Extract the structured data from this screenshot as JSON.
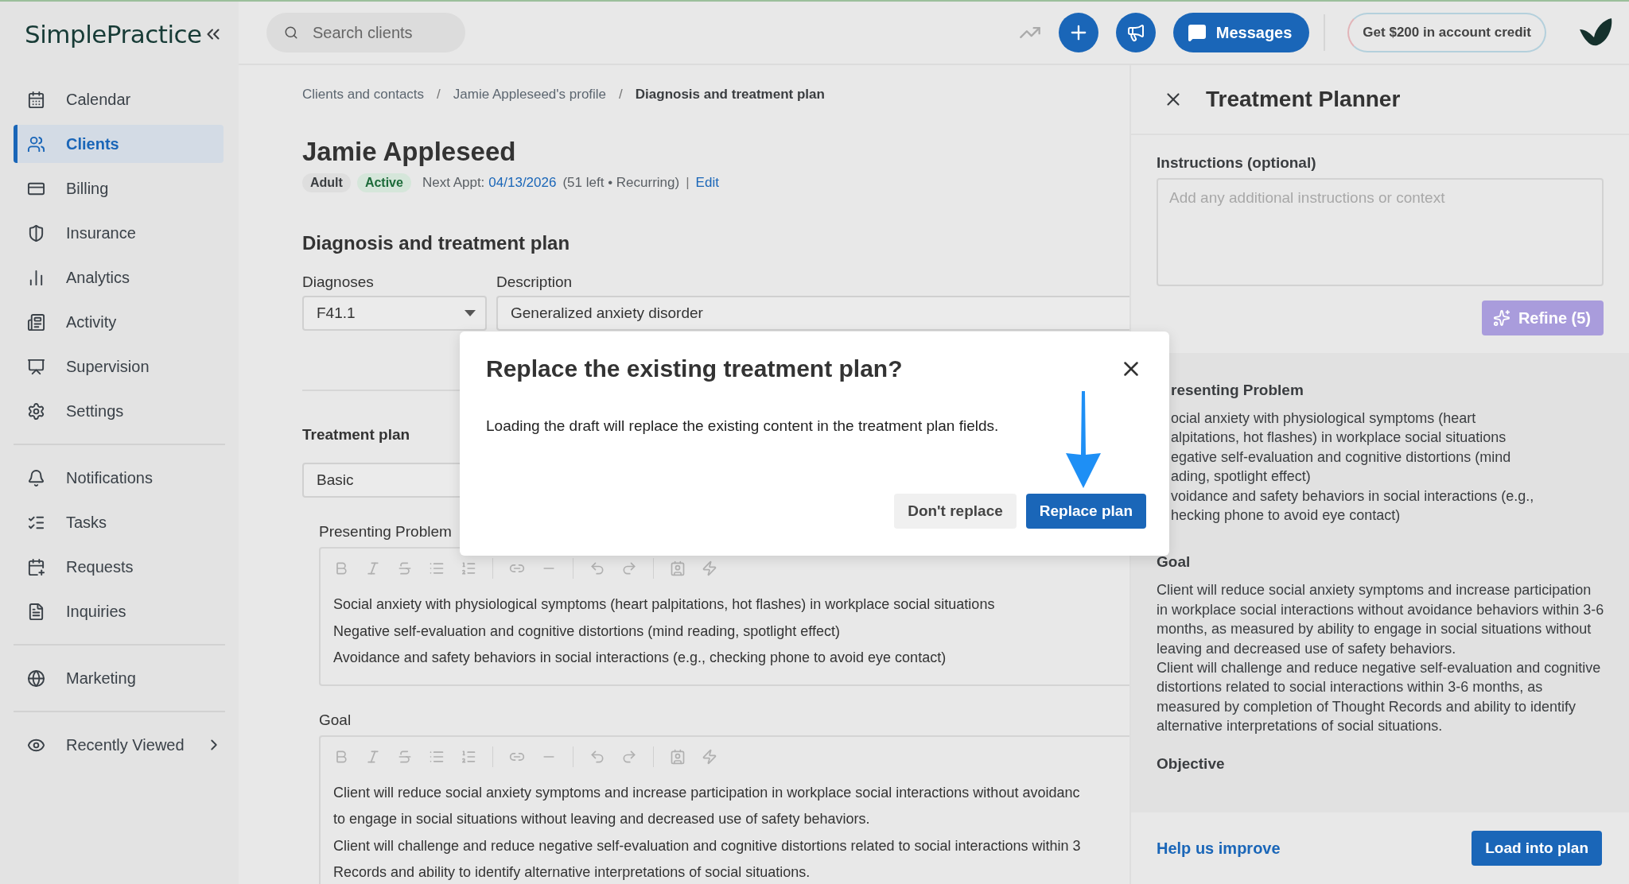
{
  "logo": {
    "text": "SimplePractice"
  },
  "sidebar": {
    "groups": [
      [
        {
          "label": "Calendar",
          "kind": "link",
          "selected": false
        },
        {
          "label": "Clients",
          "kind": "link",
          "selected": true
        },
        {
          "label": "Billing",
          "kind": "link",
          "selected": false
        },
        {
          "label": "Insurance",
          "kind": "link",
          "selected": false
        },
        {
          "label": "Analytics",
          "kind": "link",
          "selected": false
        },
        {
          "label": "Activity",
          "kind": "link",
          "selected": false
        },
        {
          "label": "Supervision",
          "kind": "link",
          "selected": false
        },
        {
          "label": "Settings",
          "kind": "link",
          "selected": false
        }
      ],
      [
        {
          "label": "Notifications",
          "kind": "link",
          "selected": false
        },
        {
          "label": "Tasks",
          "kind": "link",
          "selected": false
        },
        {
          "label": "Requests",
          "kind": "link",
          "selected": false
        },
        {
          "label": "Inquiries",
          "kind": "link",
          "selected": false
        }
      ],
      [
        {
          "label": "Marketing",
          "kind": "link",
          "selected": false
        }
      ],
      [
        {
          "label": "Recently Viewed",
          "kind": "submenu",
          "selected": false
        }
      ]
    ]
  },
  "topbar": {
    "search": {
      "placeholder": "Search clients"
    },
    "messages_button": "Messages",
    "credit_button": "Get $200 in account credit"
  },
  "breadcrumbs": [
    {
      "label": "Clients and contacts",
      "current": false
    },
    {
      "label": "Jamie Appleseed's profile",
      "current": false
    },
    {
      "label": "Diagnosis and treatment plan",
      "current": true
    }
  ],
  "breadcrumb_separator": "/",
  "client": {
    "name": "Jamie Appleseed",
    "badges": [
      {
        "label": "Adult",
        "kind": "neutral"
      },
      {
        "label": "Active",
        "kind": "success"
      }
    ],
    "next_appt_label": "Next Appt:",
    "next_appt_date": "04/13/2026",
    "next_appt_info": "(51 left • Recurring)",
    "separator": "|",
    "edit_link": "Edit"
  },
  "section_title": "Diagnosis and treatment plan",
  "diagnosis": {
    "code_label": "Diagnoses",
    "code": "F41.1",
    "description_label": "Description",
    "description": "Generalized anxiety disorder"
  },
  "treatment_plan": {
    "label": "Treatment plan",
    "template": "Basic",
    "sections": [
      {
        "label": "Presenting Problem",
        "lines": [
          "Social anxiety with physiological symptoms (heart palpitations, hot flashes) in workplace social situations",
          "Negative self-evaluation and cognitive distortions (mind reading, spotlight effect)",
          "Avoidance and safety behaviors in social interactions (e.g., checking phone to avoid eye contact)"
        ]
      },
      {
        "label": "Goal",
        "lines": [
          "Client will reduce social anxiety symptoms and increase participation in workplace social interactions without avoidanc",
          "to engage in social situations without leaving and decreased use of safety behaviors.",
          "Client will challenge and reduce negative self-evaluation and cognitive distortions related to social interactions within 3",
          "Records and ability to identify alternative interpretations of social situations."
        ]
      }
    ]
  },
  "planner": {
    "title": "Treatment Planner",
    "instructions_label": "Instructions (optional)",
    "instructions_placeholder": "Add any additional instructions or context",
    "refine_button": "Refine (5)",
    "refine_disabled": true,
    "sections": [
      {
        "heading": "resenting Problem",
        "partly_hidden": true,
        "lines": [
          "ocial anxiety with physiological symptoms (heart",
          "alpitations, hot flashes) in workplace social situations",
          "egative self-evaluation and cognitive distortions (mind",
          "ading, spotlight effect)",
          "voidance and safety behaviors in social interactions (e.g.,",
          "hecking phone to avoid eye contact)"
        ]
      },
      {
        "heading": "Goal",
        "partly_hidden": false,
        "lines": [
          "Client will reduce social anxiety symptoms and increase participation in workplace social interactions without avoidance behaviors within 3-6 months, as measured by ability to engage in social situations without leaving and decreased use of safety behaviors.",
          "Client will challenge and reduce negative self-evaluation and cognitive distortions related to social interactions within 3-6 months, as measured by completion of Thought Records and ability to identify alternative interpretations of social situations."
        ]
      },
      {
        "heading": "Objective",
        "partly_hidden": false
      }
    ],
    "footer_link": "Help us improve",
    "load_button": "Load into plan"
  },
  "dialog": {
    "title": "Replace the existing treatment plan?",
    "message": "Loading the draft will replace the existing content in the treatment plan fields.",
    "buttons": [
      {
        "label": "Don't replace",
        "kind": "secondary"
      },
      {
        "label": "Replace plan",
        "kind": "primary"
      }
    ]
  }
}
